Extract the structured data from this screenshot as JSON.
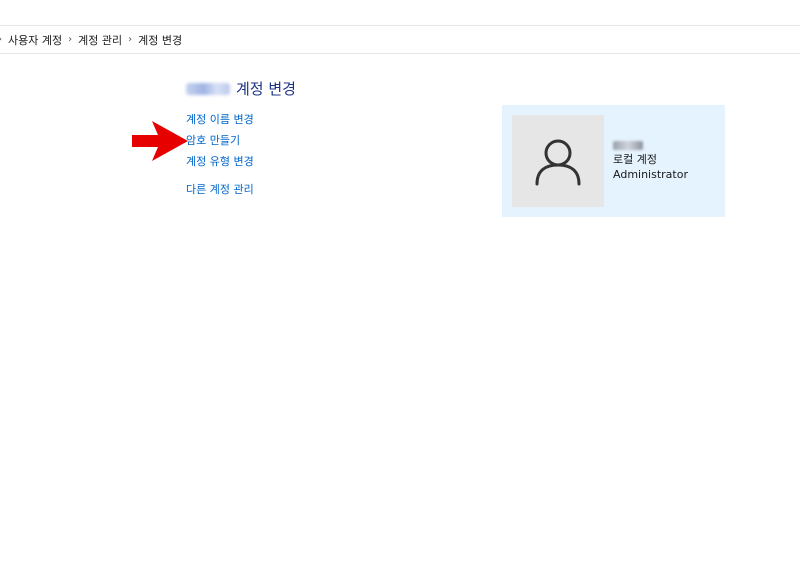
{
  "breadcrumb": {
    "items": [
      "사용자 계정",
      "계정 관리",
      "계정 변경"
    ]
  },
  "title": {
    "text": "계정 변경"
  },
  "links": {
    "rename": "계정 이름 변경",
    "create_password": "암호 만들기",
    "change_type": "계정 유형 변경",
    "manage_other": "다른 계정 관리"
  },
  "account": {
    "type": "로컬 계정",
    "role": "Administrator"
  },
  "colors": {
    "link": "#0066cc",
    "title": "#1e3287",
    "card_bg": "#e5f3fe",
    "arrow": "#e60000"
  },
  "icons": {
    "avatar": "user-silhouette-icon",
    "annotation": "red-arrow-icon"
  }
}
